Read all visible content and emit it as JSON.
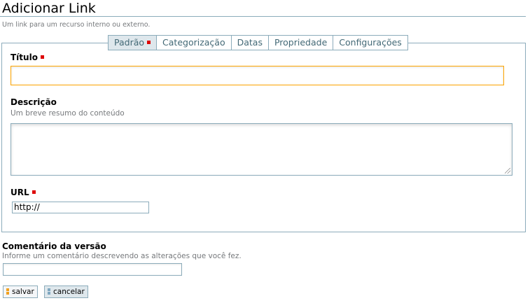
{
  "header": {
    "title": "Adicionar Link",
    "subtitle": "Um link para um recurso interno ou externo."
  },
  "tabs": [
    {
      "label": "Padrão",
      "required": true,
      "active": true
    },
    {
      "label": "Categorização"
    },
    {
      "label": "Datas"
    },
    {
      "label": "Propriedade"
    },
    {
      "label": "Configurações"
    }
  ],
  "fields": {
    "title": {
      "label": "Título",
      "value": ""
    },
    "description": {
      "label": "Descrição",
      "help": "Um breve resumo do conteúdo",
      "value": ""
    },
    "url": {
      "label": "URL",
      "value": "http://"
    }
  },
  "comment": {
    "label": "Comentário da versão",
    "help": "Informe um comentário descrevendo as alterações que você fez.",
    "value": ""
  },
  "buttons": {
    "save": "salvar",
    "cancel": "cancelar"
  },
  "colors": {
    "border": "#8cacbb",
    "focus": "#ffa500",
    "required": "#dd0000"
  }
}
